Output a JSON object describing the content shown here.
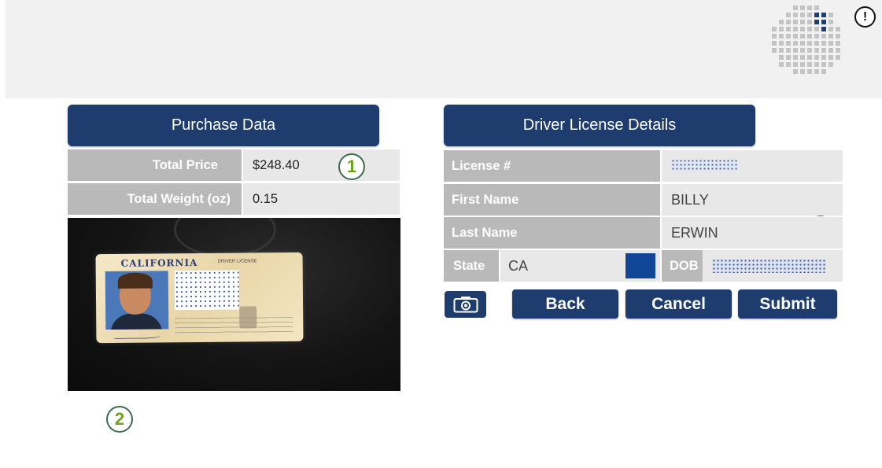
{
  "header": {
    "logo_icon": "grid-logo-icon",
    "alert_icon": "alert-circle-icon",
    "alert_glyph": "!"
  },
  "purchase": {
    "title": "Purchase Data",
    "rows": [
      {
        "label": "Total Price",
        "value": "$248.40"
      },
      {
        "label": "Total Weight (oz)",
        "value": "0.15"
      }
    ]
  },
  "license_image": {
    "state_text": "CALIFORNIA",
    "doc_type": "DRIVER LICENSE"
  },
  "driver": {
    "title": "Driver License Details",
    "license_label": "License #",
    "license_value_suffix": "3",
    "first_name_label": "First Name",
    "first_name_value": "BILLY",
    "last_name_label": "Last Name",
    "last_name_value": "ERWIN",
    "state_label": "State",
    "state_value": "CA",
    "state_color": "#0f4796",
    "dob_label": "DOB"
  },
  "markers": [
    "1",
    "2",
    "3"
  ],
  "actions": {
    "camera_icon": "camera-icon",
    "back": "Back",
    "cancel": "Cancel",
    "submit": "Submit"
  },
  "colors": {
    "accent": "#1f3c6f",
    "label_bg": "#b9b9b9",
    "value_bg": "#e8e8e8",
    "marker_text": "#6ea11e"
  }
}
